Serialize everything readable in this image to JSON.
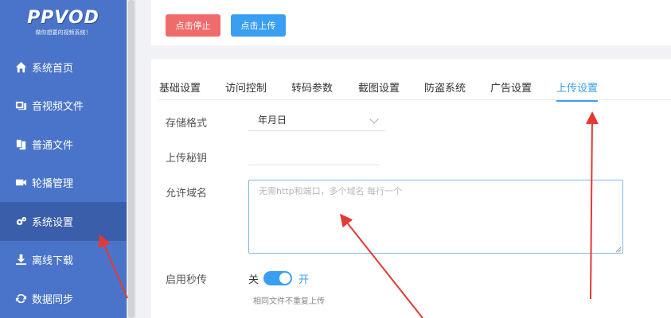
{
  "logo": {
    "main": "PPVOD",
    "sub": "做你想要的视频系统！"
  },
  "sidebar": {
    "items": [
      {
        "label": "系统首页",
        "icon": "home-icon"
      },
      {
        "label": "音视频文件",
        "icon": "media-files-icon"
      },
      {
        "label": "普通文件",
        "icon": "files-icon"
      },
      {
        "label": "轮播管理",
        "icon": "video-camera-icon"
      },
      {
        "label": "系统设置",
        "icon": "gears-icon",
        "active": true
      },
      {
        "label": "离线下载",
        "icon": "download-icon"
      },
      {
        "label": "数据同步",
        "icon": "sync-icon"
      }
    ]
  },
  "toolbar": {
    "stop_label": "点击停止",
    "upload_label": "点击上传"
  },
  "tabs": [
    {
      "label": "基础设置"
    },
    {
      "label": "访问控制"
    },
    {
      "label": "转码参数"
    },
    {
      "label": "截图设置"
    },
    {
      "label": "防盗系统"
    },
    {
      "label": "广告设置"
    },
    {
      "label": "上传设置",
      "active": true
    }
  ],
  "form": {
    "storage_format": {
      "label": "存储格式",
      "value": "年月日"
    },
    "upload_key": {
      "label": "上传秘钥",
      "value": ""
    },
    "allowed_domains": {
      "label": "允许域名",
      "placeholder": "无需http和端口，多个域名 每行一个"
    },
    "instant_upload": {
      "label": "启用秒传",
      "off_label": "关",
      "on_label": "开",
      "enabled": true,
      "hint": "相同文件不重复上传"
    }
  },
  "colors": {
    "sidebar": "#4a74c9",
    "sidebar_active": "#3a5ea9",
    "primary": "#3a9ff2",
    "danger": "#f06b6b",
    "annotation": "#e53935"
  }
}
